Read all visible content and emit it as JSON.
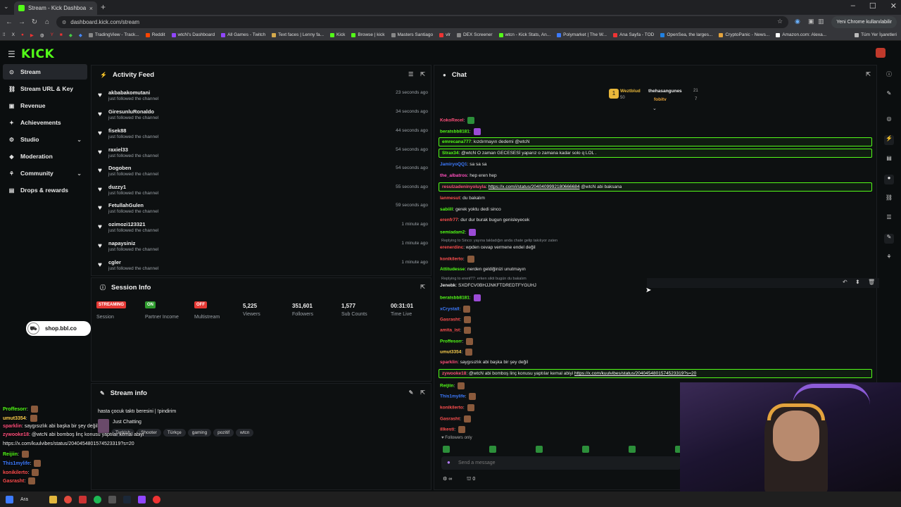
{
  "browser": {
    "tab_title": "Stream - Kick Dashboard",
    "new_tab": "+",
    "url": "dashboard.kick.com/stream",
    "profile_label": "Yeni Chrome kullanılabilir",
    "bookmarks": [
      "TradingView - Track...",
      "Reddit",
      "wtcN's Dashboard",
      "All Games - Twitch",
      "Text faces | Lenny fa...",
      "Kick",
      "Browse | kick",
      "Masters Santiago",
      "vlr",
      "DEX Screener",
      "wtcn - Kick Stats, An...",
      "Polymarket | The W...",
      "Ana Sayfa - TOD",
      "OpenSea, the larges...",
      "CryptoPanic - News...",
      "Amazon.com: Alexa..."
    ],
    "all_bookmarks": "Tüm Yer İşaretleri"
  },
  "header": {
    "logo": "KICK"
  },
  "sidebar": {
    "items": [
      {
        "label": "Stream",
        "icon": "broadcast-icon",
        "glyph": "⊙"
      },
      {
        "label": "Stream URL & Key",
        "icon": "link-icon",
        "glyph": "⛓"
      },
      {
        "label": "Revenue",
        "icon": "wallet-icon",
        "glyph": "▣"
      },
      {
        "label": "Achievements",
        "icon": "trophy-icon",
        "glyph": "✦"
      },
      {
        "label": "Studio",
        "icon": "studio-icon",
        "glyph": "⚙"
      },
      {
        "label": "Moderation",
        "icon": "shield-icon",
        "glyph": "◆"
      },
      {
        "label": "Community",
        "icon": "community-icon",
        "glyph": "⚘"
      },
      {
        "label": "Drops & rewards",
        "icon": "gift-icon",
        "glyph": "▤"
      }
    ]
  },
  "activity_feed": {
    "title": "Activity Feed",
    "events": [
      {
        "name": "akbabakomutani",
        "text": "just followed the channel",
        "time": "23 seconds ago"
      },
      {
        "name": "GiresunluRonaldo",
        "text": "just followed the channel",
        "time": "34 seconds ago"
      },
      {
        "name": "fisek88",
        "text": "just followed the channel",
        "time": "44 seconds ago"
      },
      {
        "name": "raxiel33",
        "text": "just followed the channel",
        "time": "54 seconds ago"
      },
      {
        "name": "Dogoben",
        "text": "just followed the channel",
        "time": "54 seconds ago"
      },
      {
        "name": "duzzy1",
        "text": "just followed the channel",
        "time": "55 seconds ago"
      },
      {
        "name": "FetullahGulen",
        "text": "just followed the channel",
        "time": "59 seconds ago"
      },
      {
        "name": "ozimozi123321",
        "text": "just followed the channel",
        "time": "1 minute ago"
      },
      {
        "name": "napaysiniz",
        "text": "just followed the channel",
        "time": "1 minute ago"
      },
      {
        "name": "cgler",
        "text": "just followed the channel",
        "time": "1 minute ago"
      }
    ]
  },
  "session_info": {
    "title": "Session Info",
    "stats": [
      {
        "badge": "STREAMING",
        "badge_color": "#e53935",
        "label": "Session"
      },
      {
        "badge": "ON",
        "badge_color": "#2e9b2e",
        "label": "Partner Income"
      },
      {
        "badge": "OFF",
        "badge_color": "#e53935",
        "label": "Multistream"
      },
      {
        "value": "5,225",
        "label": "Viewers"
      },
      {
        "value": "351,601",
        "label": "Followers"
      },
      {
        "value": "1,577",
        "label": "Sub Counts"
      },
      {
        "value": "00:31:01",
        "label": "Time Live"
      }
    ]
  },
  "stream_info": {
    "title": "Stream info",
    "stream_title": "hasta çocuk taktı beresini | !pindirim",
    "category": "Just Chatting",
    "tags": [
      "Turkish",
      "Shooter",
      "Türkçe",
      "gaming",
      "pozitif",
      "wtcn"
    ]
  },
  "chat": {
    "title": "Chat",
    "leaderboard": [
      {
        "name": "Weztblud",
        "amount": "50"
      },
      {
        "name": "thehasangunes",
        "amount": "21"
      },
      {
        "name": "fobitv",
        "amount": "7"
      }
    ],
    "messages": [
      {
        "user": "KokoRecel",
        "color": "#ff4f7b",
        "text": "",
        "emote": "g"
      },
      {
        "user": "beratsbb8181",
        "color": "#53fc18",
        "text": "",
        "emote": "p"
      },
      {
        "user": "emrecana777",
        "color": "#53fc18",
        "text": "kızdırmayın dedemi @wtcN",
        "highlight": true
      },
      {
        "user": "Strax34",
        "color": "#53fc18",
        "text": "@wtcN O zaman GECESESİ yaparız o zamana kadar solo q LOL .",
        "highlight": true
      },
      {
        "user": "JamiryoQQ1",
        "color": "#3d7bff",
        "text": "sa sa sa"
      },
      {
        "user": "the_albatros",
        "color": "#ff4fbd",
        "text": "hep eren hep"
      },
      {
        "user": "resulzadeninyoluyla",
        "color": "#ff4f7b",
        "text": "",
        "link": "https://x.com/i/status/2040409992180666684",
        "suffix": " @wtcN abi baksana",
        "highlight": true
      },
      {
        "user": "lanmesut",
        "color": "#ff4f4f",
        "text": "du bakalım"
      },
      {
        "user": "sabiill",
        "color": "#53fc18",
        "text": "gerek yoktu dedi sinco"
      },
      {
        "user": "erenfr77",
        "color": "#ff4f4f",
        "text": "dur dur burak bugun genisleyecek"
      },
      {
        "user": "semiadam2",
        "color": "#53fc18",
        "text": "",
        "emote": "p"
      },
      {
        "reply": "Replying to Sinco: yayına takladığın anda chate gelip takılıyor zaten"
      },
      {
        "user": "erenerdinc",
        "color": "#ff4f4f",
        "text": "wpden cevap vermene endel değil"
      },
      {
        "user": "konikilerto",
        "color": "#ff4f4f",
        "text": "",
        "emote": "b"
      },
      {
        "user": "Attitudesse",
        "color": "#53fc18",
        "text": "nerden geldiğinizi unutmayın"
      },
      {
        "reply": "Replying to erenf77: erken sikti bugün du bakalım"
      },
      {
        "user": "Jenebk",
        "color": "#e5e5e5",
        "text": "SXDFCV0BHJJNKFTDREDTFYGUHJ"
      },
      {
        "user": "beratsbb8181",
        "color": "#53fc18",
        "text": "",
        "emote": "p"
      },
      {
        "user": "xCrystall",
        "color": "#3d7bff",
        "text": "",
        "emote": "b"
      },
      {
        "user": "Gasrasht",
        "color": "#ff4f4f",
        "text": "",
        "emote": "b"
      },
      {
        "user": "amita_ist",
        "color": "#ff4f4f",
        "text": "",
        "emote": "b"
      },
      {
        "user": "Proffesorr",
        "color": "#53fc18",
        "text": "",
        "emote": "b"
      },
      {
        "user": "umut3354",
        "color": "#ffd24f",
        "text": "",
        "emote": "b"
      },
      {
        "user": "sparklin",
        "color": "#ff4f7b",
        "text": "saygısızlık abi başka bir şey değil"
      },
      {
        "user": "zywooke18",
        "color": "#ff4f7b",
        "text": "@wtcN abi bomboş linç konusu yaptılar kemal abiyi ",
        "link": "https://x.com/kuulvibes/status/2040454801574523319?s=20",
        "highlight": true
      },
      {
        "user": "Reijiin",
        "color": "#53fc18",
        "text": "",
        "emote": "b"
      },
      {
        "user": "This1mylife",
        "color": "#3d7bff",
        "text": "",
        "emote": "b"
      },
      {
        "user": "konikilerto",
        "color": "#ff4f4f",
        "text": "",
        "emote": "b"
      },
      {
        "user": "Gasrasht",
        "color": "#ff4f4f",
        "text": "",
        "emote": "b"
      },
      {
        "user": "illkesti",
        "color": "#ff4f4f",
        "text": "",
        "emote": "b"
      }
    ],
    "followers_only": "Followers only",
    "input_placeholder": "Send a message",
    "points": "0"
  },
  "overlay": {
    "shop": "shop.bbl.co",
    "chat": [
      {
        "user": "Proffesorr",
        "color": "#53fc18",
        "text": ""
      },
      {
        "user": "umut3354",
        "color": "#ffd24f",
        "text": ""
      },
      {
        "user": "sparklin",
        "color": "#ff4f7b",
        "text": "saygısızlık abi başka bir şey değil"
      },
      {
        "user": "zywooke18",
        "color": "#ff4f7b",
        "text": "@wtcN abi bomboş linç konusu yaptılar kemal abiyi"
      },
      {
        "user": "",
        "color": "#f0f0f0",
        "text": "https://x.com/kuulvibes/status/2040454801574523319?s=20"
      },
      {
        "user": "Reijiin",
        "color": "#53fc18",
        "text": ""
      },
      {
        "user": "This1mylife",
        "color": "#3d7bff",
        "text": ""
      },
      {
        "user": "konikilerto",
        "color": "#ff4f4f",
        "text": ""
      },
      {
        "user": "Gasrasht",
        "color": "#ff4f4f",
        "text": ""
      }
    ]
  },
  "taskbar": {
    "search": "Ara"
  }
}
